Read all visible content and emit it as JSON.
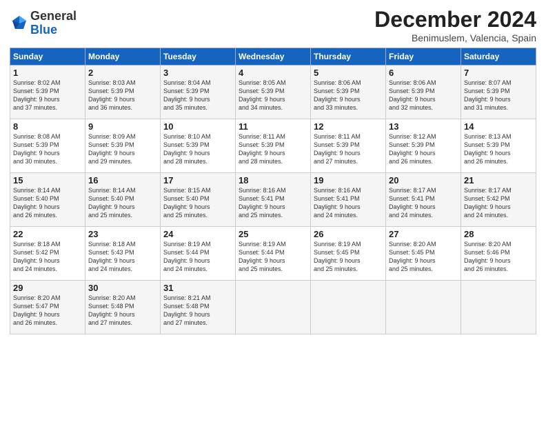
{
  "header": {
    "logo_line1": "General",
    "logo_line2": "Blue",
    "month_title": "December 2024",
    "location": "Benimuslem, Valencia, Spain"
  },
  "calendar": {
    "days_of_week": [
      "Sunday",
      "Monday",
      "Tuesday",
      "Wednesday",
      "Thursday",
      "Friday",
      "Saturday"
    ],
    "weeks": [
      [
        {
          "day": "",
          "text": ""
        },
        {
          "day": "2",
          "text": "Sunrise: 8:03 AM\nSunset: 5:39 PM\nDaylight: 9 hours\nand 36 minutes."
        },
        {
          "day": "3",
          "text": "Sunrise: 8:04 AM\nSunset: 5:39 PM\nDaylight: 9 hours\nand 35 minutes."
        },
        {
          "day": "4",
          "text": "Sunrise: 8:05 AM\nSunset: 5:39 PM\nDaylight: 9 hours\nand 34 minutes."
        },
        {
          "day": "5",
          "text": "Sunrise: 8:06 AM\nSunset: 5:39 PM\nDaylight: 9 hours\nand 33 minutes."
        },
        {
          "day": "6",
          "text": "Sunrise: 8:06 AM\nSunset: 5:39 PM\nDaylight: 9 hours\nand 32 minutes."
        },
        {
          "day": "7",
          "text": "Sunrise: 8:07 AM\nSunset: 5:39 PM\nDaylight: 9 hours\nand 31 minutes."
        }
      ],
      [
        {
          "day": "8",
          "text": "Sunrise: 8:08 AM\nSunset: 5:39 PM\nDaylight: 9 hours\nand 30 minutes."
        },
        {
          "day": "9",
          "text": "Sunrise: 8:09 AM\nSunset: 5:39 PM\nDaylight: 9 hours\nand 29 minutes."
        },
        {
          "day": "10",
          "text": "Sunrise: 8:10 AM\nSunset: 5:39 PM\nDaylight: 9 hours\nand 28 minutes."
        },
        {
          "day": "11",
          "text": "Sunrise: 8:11 AM\nSunset: 5:39 PM\nDaylight: 9 hours\nand 28 minutes."
        },
        {
          "day": "12",
          "text": "Sunrise: 8:11 AM\nSunset: 5:39 PM\nDaylight: 9 hours\nand 27 minutes."
        },
        {
          "day": "13",
          "text": "Sunrise: 8:12 AM\nSunset: 5:39 PM\nDaylight: 9 hours\nand 26 minutes."
        },
        {
          "day": "14",
          "text": "Sunrise: 8:13 AM\nSunset: 5:39 PM\nDaylight: 9 hours\nand 26 minutes."
        }
      ],
      [
        {
          "day": "15",
          "text": "Sunrise: 8:14 AM\nSunset: 5:40 PM\nDaylight: 9 hours\nand 26 minutes."
        },
        {
          "day": "16",
          "text": "Sunrise: 8:14 AM\nSunset: 5:40 PM\nDaylight: 9 hours\nand 25 minutes."
        },
        {
          "day": "17",
          "text": "Sunrise: 8:15 AM\nSunset: 5:40 PM\nDaylight: 9 hours\nand 25 minutes."
        },
        {
          "day": "18",
          "text": "Sunrise: 8:16 AM\nSunset: 5:41 PM\nDaylight: 9 hours\nand 25 minutes."
        },
        {
          "day": "19",
          "text": "Sunrise: 8:16 AM\nSunset: 5:41 PM\nDaylight: 9 hours\nand 24 minutes."
        },
        {
          "day": "20",
          "text": "Sunrise: 8:17 AM\nSunset: 5:41 PM\nDaylight: 9 hours\nand 24 minutes."
        },
        {
          "day": "21",
          "text": "Sunrise: 8:17 AM\nSunset: 5:42 PM\nDaylight: 9 hours\nand 24 minutes."
        }
      ],
      [
        {
          "day": "22",
          "text": "Sunrise: 8:18 AM\nSunset: 5:42 PM\nDaylight: 9 hours\nand 24 minutes."
        },
        {
          "day": "23",
          "text": "Sunrise: 8:18 AM\nSunset: 5:43 PM\nDaylight: 9 hours\nand 24 minutes."
        },
        {
          "day": "24",
          "text": "Sunrise: 8:19 AM\nSunset: 5:44 PM\nDaylight: 9 hours\nand 24 minutes."
        },
        {
          "day": "25",
          "text": "Sunrise: 8:19 AM\nSunset: 5:44 PM\nDaylight: 9 hours\nand 25 minutes."
        },
        {
          "day": "26",
          "text": "Sunrise: 8:19 AM\nSunset: 5:45 PM\nDaylight: 9 hours\nand 25 minutes."
        },
        {
          "day": "27",
          "text": "Sunrise: 8:20 AM\nSunset: 5:45 PM\nDaylight: 9 hours\nand 25 minutes."
        },
        {
          "day": "28",
          "text": "Sunrise: 8:20 AM\nSunset: 5:46 PM\nDaylight: 9 hours\nand 26 minutes."
        }
      ],
      [
        {
          "day": "29",
          "text": "Sunrise: 8:20 AM\nSunset: 5:47 PM\nDaylight: 9 hours\nand 26 minutes."
        },
        {
          "day": "30",
          "text": "Sunrise: 8:20 AM\nSunset: 5:48 PM\nDaylight: 9 hours\nand 27 minutes."
        },
        {
          "day": "31",
          "text": "Sunrise: 8:21 AM\nSunset: 5:48 PM\nDaylight: 9 hours\nand 27 minutes."
        },
        {
          "day": "",
          "text": ""
        },
        {
          "day": "",
          "text": ""
        },
        {
          "day": "",
          "text": ""
        },
        {
          "day": "",
          "text": ""
        }
      ]
    ],
    "week1_day1": {
      "day": "1",
      "text": "Sunrise: 8:02 AM\nSunset: 5:39 PM\nDaylight: 9 hours\nand 37 minutes."
    }
  }
}
